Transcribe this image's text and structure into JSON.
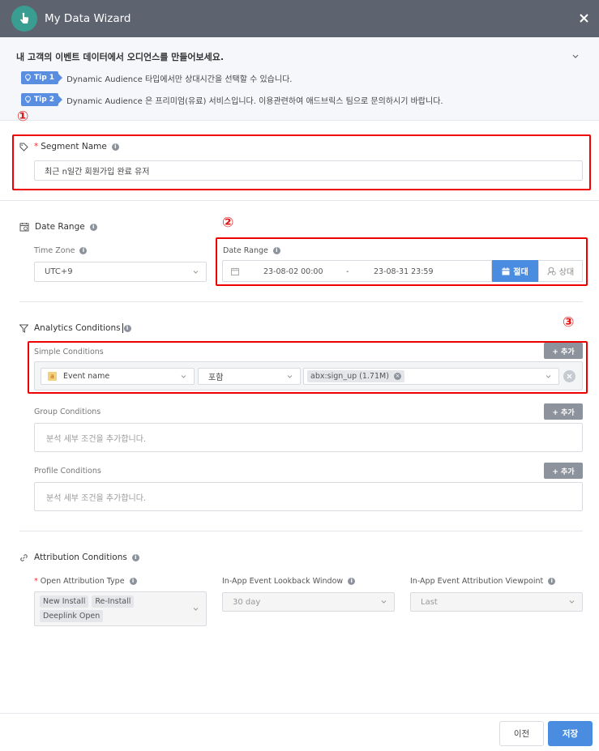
{
  "window": {
    "title": "My Data Wizard"
  },
  "intro": {
    "title": "내 고객의 이벤트 데이터에서 오디언스를 만들어보세요.",
    "tips": [
      {
        "badge": "Tip 1",
        "text": "Dynamic Audience 타입에서만 상대시간을 선택할 수 있습니다."
      },
      {
        "badge": "Tip 2",
        "text": "Dynamic Audience 은 프리미엄(유료) 서비스입니다. 이용관련하여 애드브릭스 팀으로 문의하시기 바랍니다."
      }
    ]
  },
  "markers": {
    "one": "①",
    "two": "②",
    "three": "③"
  },
  "segment": {
    "required": "*",
    "label": "Segment Name",
    "value": "최근 n일간 회원가입 완료 유저"
  },
  "date_section": {
    "label": "Date Range",
    "timezone_label": "Time Zone",
    "timezone_value": "UTC+9",
    "range_label": "Date Range",
    "start": "23-08-02 00:00",
    "separator": "-",
    "end": "23-08-31 23:59",
    "absolute": "절대",
    "relative": "상대"
  },
  "analytics": {
    "label": "Analytics Conditions",
    "simple_label": "Simple Conditions",
    "add_label": "+ 추가",
    "event_badge": "a",
    "event_field": "Event name",
    "operator": "포함",
    "value_tag": "abx:sign_up (1.71M)",
    "group_label": "Group Conditions",
    "group_placeholder": "분석 세부 조건을 추가합니다.",
    "profile_label": "Profile Conditions",
    "profile_placeholder": "분석 세부 조건을 추가합니다."
  },
  "attribution": {
    "label": "Attribution Conditions",
    "open_required": "*",
    "open_label": "Open Attribution Type",
    "open_tags": [
      "New Install",
      "Re-Install",
      "Deeplink Open"
    ],
    "lookback_label": "In-App Event Lookback Window",
    "lookback_value": "30 day",
    "viewpoint_label": "In-App Event Attribution Viewpoint",
    "viewpoint_value": "Last"
  },
  "footer": {
    "prev": "이전",
    "save": "저장"
  },
  "colors": {
    "header": "#5d6470",
    "primary": "#4a8de0",
    "marker": "#e00000",
    "gray_button": "#8d939c"
  }
}
